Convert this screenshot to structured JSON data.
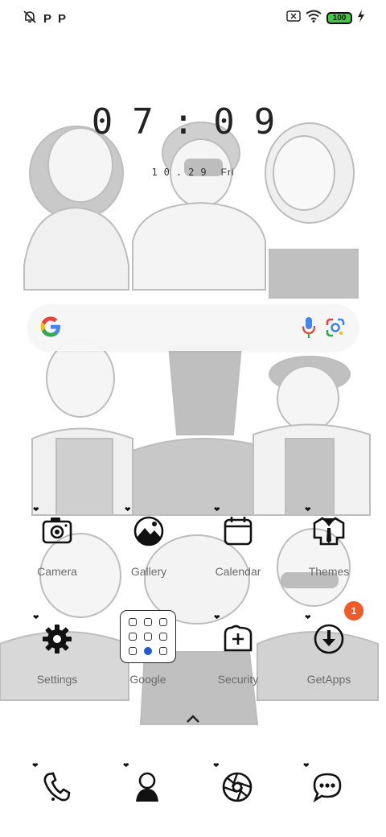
{
  "status_bar": {
    "left_icons": [
      "bell-off-icon",
      "p-icon",
      "p-icon"
    ],
    "p_labels": [
      "P",
      "P"
    ],
    "battery_level": "100",
    "right_icons": [
      "sim-off-icon",
      "wifi-icon",
      "battery-icon",
      "charging-bolt-icon"
    ]
  },
  "clock": {
    "time": "07:09",
    "date": "10.29",
    "day": "Fri"
  },
  "search_bar": {
    "icons": [
      "google-g-icon",
      "microphone-icon",
      "google-lens-icon"
    ]
  },
  "apps": [
    {
      "label": "Camera",
      "icon": "camera-icon"
    },
    {
      "label": "Gallery",
      "icon": "gallery-icon"
    },
    {
      "label": "Calendar",
      "icon": "calendar-icon"
    },
    {
      "label": "Themes",
      "icon": "themes-icon"
    },
    {
      "label": "Settings",
      "icon": "gear-icon"
    },
    {
      "label": "Google",
      "icon": "folder-icon"
    },
    {
      "label": "Security",
      "icon": "security-icon"
    },
    {
      "label": "GetApps",
      "icon": "download-icon"
    }
  ],
  "getapps_badge": "1",
  "dock": [
    {
      "icon": "phone-icon"
    },
    {
      "icon": "contacts-icon"
    },
    {
      "icon": "browser-icon"
    },
    {
      "icon": "messages-icon"
    }
  ],
  "colors": {
    "battery": "#3dcc3d",
    "badge": "#f15a24",
    "label": "#6a6a6a",
    "wallpaper_gray": "#c8c8c8"
  }
}
